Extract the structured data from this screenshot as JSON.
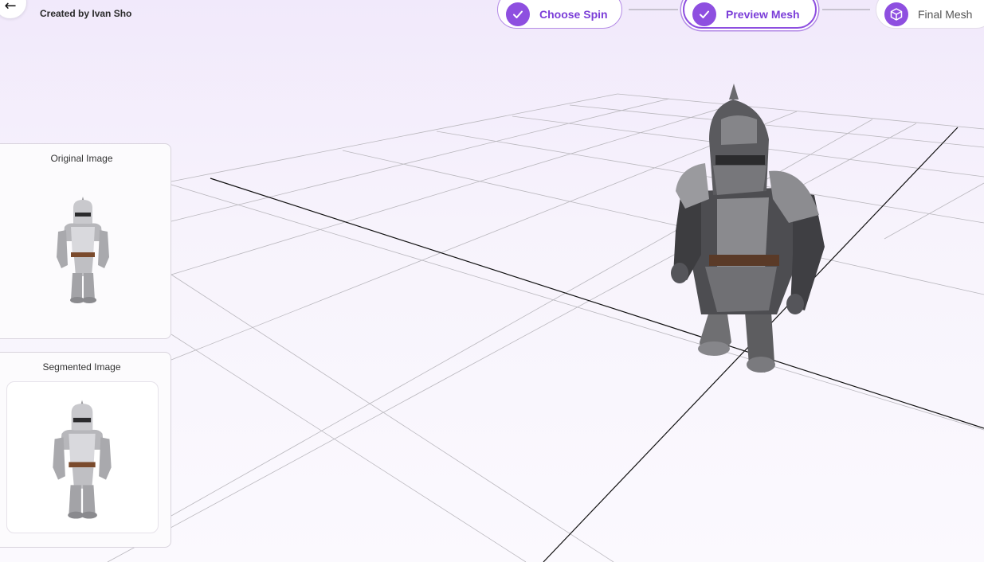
{
  "header": {
    "created_by": "Created by Ivan Sho"
  },
  "steps": [
    {
      "label": "Choose Spin",
      "icon": "check-icon",
      "state": "done"
    },
    {
      "label": "Preview Mesh",
      "icon": "check-icon",
      "state": "active"
    },
    {
      "label": "Final Mesh",
      "icon": "cube-icon",
      "state": "pending"
    }
  ],
  "panels": {
    "original_title": "Original Image",
    "segmented_title": "Segmented Image"
  },
  "colors": {
    "accent": "#8e4fe0",
    "accent_light": "#b48be6",
    "background": "#f4eefb"
  }
}
